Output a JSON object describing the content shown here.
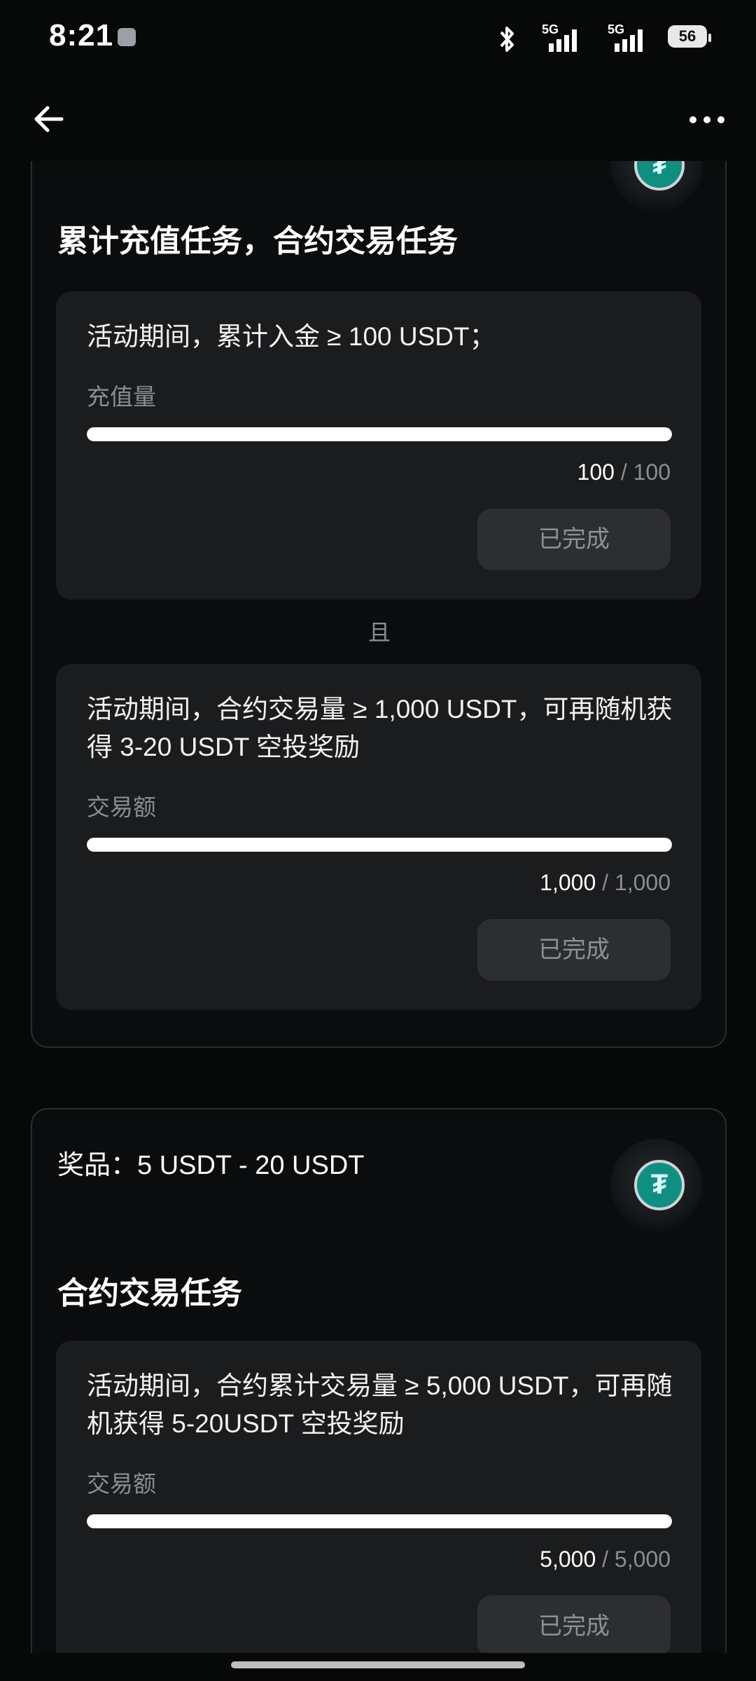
{
  "status_bar": {
    "time": "8:21",
    "network1": "5G",
    "network2": "5G",
    "battery": "56"
  },
  "nav": {
    "back_icon": "back-arrow-icon",
    "more_icon": "more-dots-icon"
  },
  "card1": {
    "title": "累计充值任务，合约交易任务",
    "tasks": [
      {
        "description": "活动期间，累计入金 ≥ 100 USDT；",
        "label": "充值量",
        "progress_current": "100",
        "progress_sep": "/",
        "progress_target": "100",
        "progress_fraction": 1.0,
        "button": "已完成"
      },
      {
        "description": "活动期间，合约交易量 ≥ 1,000 USDT，可再随机获得 3-20 USDT 空投奖励",
        "label": "交易额",
        "progress_current": "1,000",
        "progress_sep": "/",
        "progress_target": "1,000",
        "progress_fraction": 1.0,
        "button": "已完成"
      }
    ],
    "connector": "且"
  },
  "card2": {
    "prize": "奖品：5 USDT - 20 USDT",
    "title": "合约交易任务",
    "tasks": [
      {
        "description": "活动期间，合约累计交易量 ≥ 5,000 USDT，可再随机获得 5-20USDT 空投奖励",
        "label": "交易额",
        "progress_current": "5,000",
        "progress_sep": "/",
        "progress_target": "5,000",
        "progress_fraction": 1.0,
        "button": "已完成"
      }
    ]
  },
  "colors": {
    "background": "#070909",
    "task_bg": "#1b1c1e",
    "progress": "#ffffff",
    "muted": "#8a8d91"
  }
}
